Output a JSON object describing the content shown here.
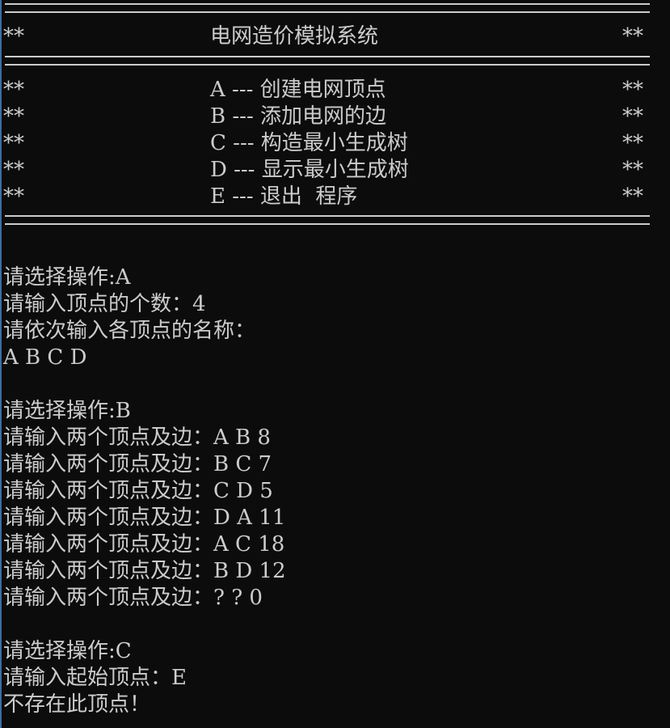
{
  "colors": {
    "background": "#0c0c0c",
    "text": "#cccccc",
    "edge_accent": "#3a6ea5"
  },
  "banner": {
    "title": "电网造价模拟系统",
    "border_stars": "**",
    "menu": [
      "A --- 创建电网顶点",
      "B --- 添加电网的边",
      "C --- 构造最小生成树",
      "D --- 显示最小生成树",
      "E --- 退出  程序"
    ]
  },
  "output": [
    "请选择操作:A",
    "请输入顶点的个数：4",
    "请依次输入各顶点的名称：",
    "A B C D",
    "",
    "请选择操作:B",
    "请输入两个顶点及边：A B 8",
    "请输入两个顶点及边：B C 7",
    "请输入两个顶点及边：C D 5",
    "请输入两个顶点及边：D A 11",
    "请输入两个顶点及边：A C 18",
    "请输入两个顶点及边：B D 12",
    "请输入两个顶点及边：? ? 0",
    "",
    "请选择操作:C",
    "请输入起始顶点：E",
    "不存在此顶点！"
  ]
}
